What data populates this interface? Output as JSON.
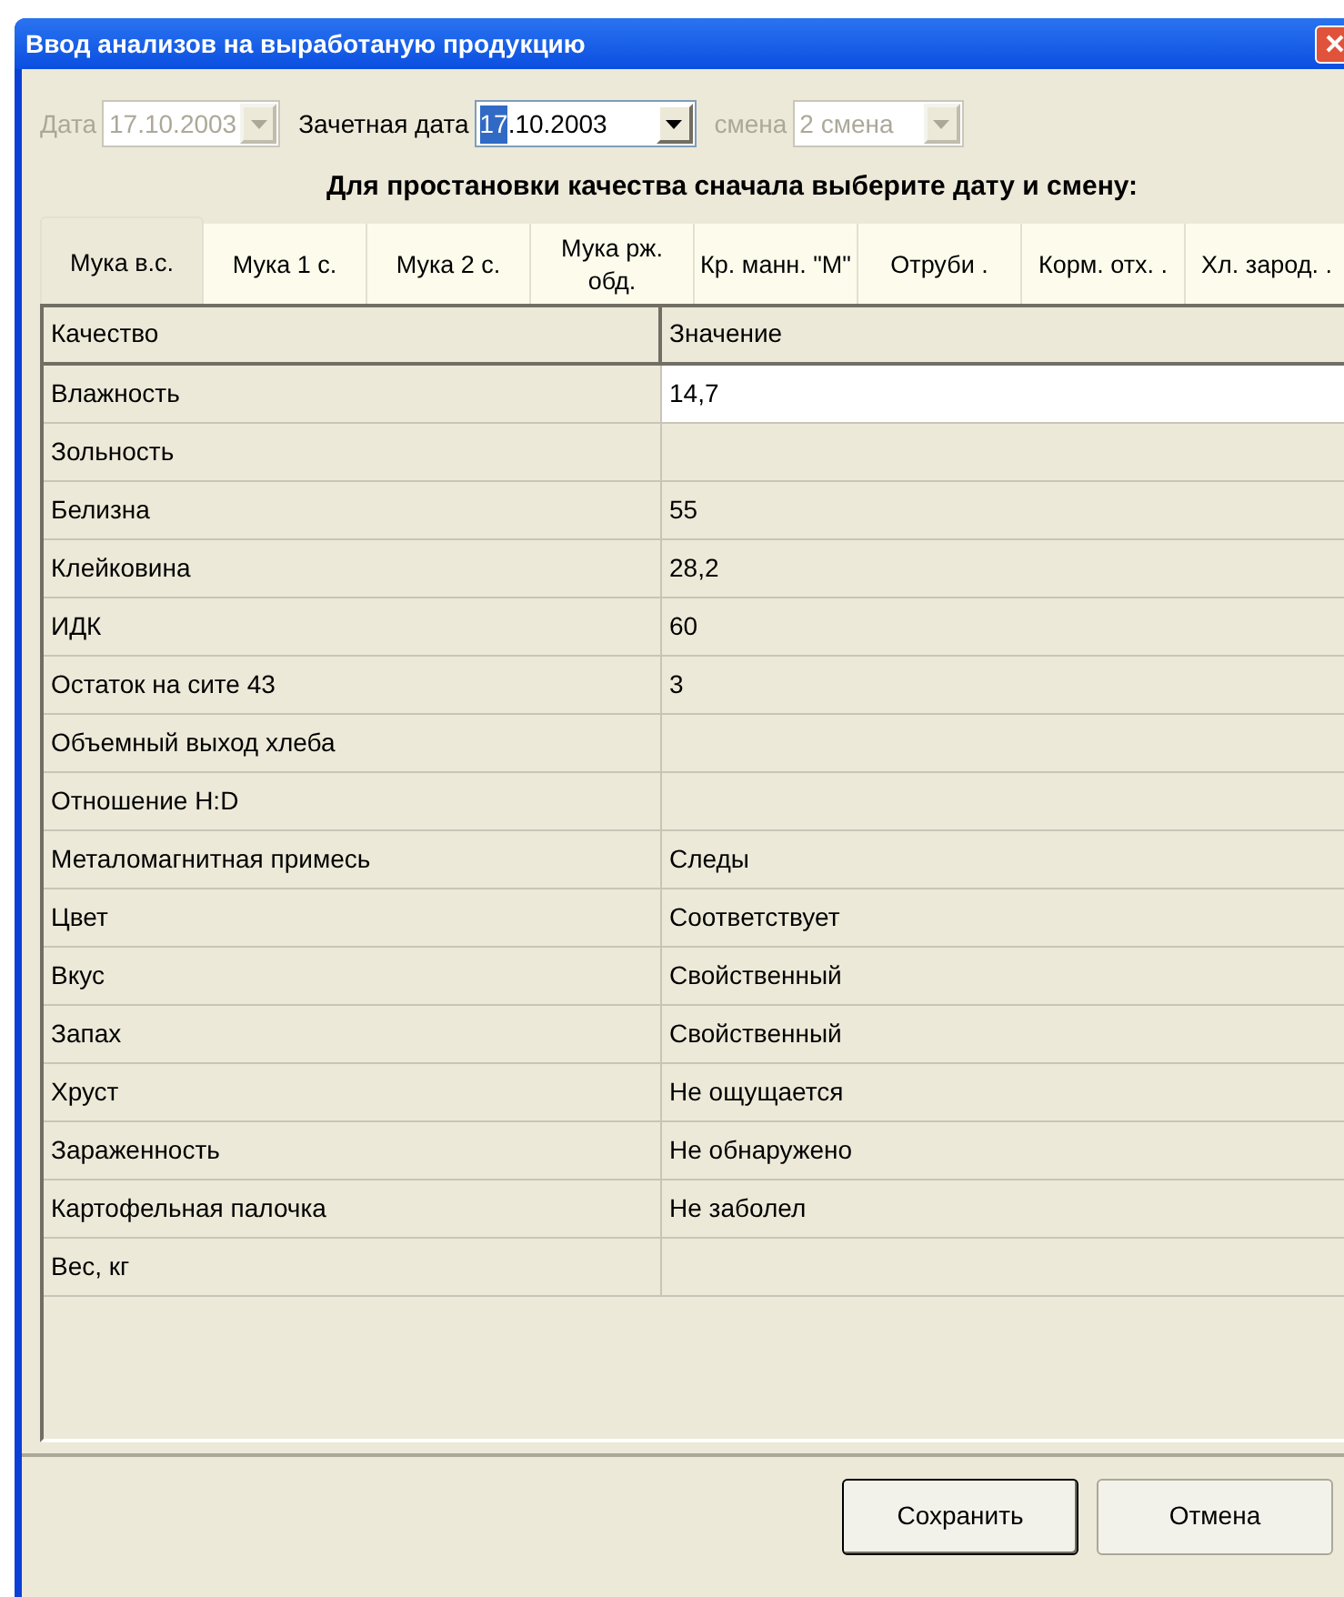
{
  "window": {
    "title": "Ввод анализов на выработаную продукцию"
  },
  "filters": [
    {
      "kind": "combo",
      "label": "Дата",
      "value": "17.10.2003",
      "disabled": true
    },
    {
      "kind": "date",
      "label": "Зачетная дата",
      "highlighted": "17",
      "rest": ".10.2003",
      "disabled": false
    },
    {
      "kind": "combo",
      "label": "смена",
      "value": "2 смена",
      "disabled": true
    }
  ],
  "instruction": "Для простановки качества сначала выберите дату и смену:",
  "tabs": [
    {
      "label": "Мука в.с.",
      "selected": true
    },
    {
      "label": "Мука 1 с.",
      "selected": false
    },
    {
      "label": "Мука 2 с.",
      "selected": false
    },
    {
      "label": "Мука рж. обд.",
      "selected": false
    },
    {
      "label": "Кр. манн. \"М\"",
      "selected": false
    },
    {
      "label": "Отруби .",
      "selected": false
    },
    {
      "label": "Корм. отх. .",
      "selected": false
    },
    {
      "label": "Хл. зарод. .",
      "selected": false
    }
  ],
  "table": {
    "columns": [
      "Качество",
      "Значение"
    ],
    "rows": [
      {
        "quality": "Влажность",
        "value": "14,7",
        "selected": true
      },
      {
        "quality": "Зольность",
        "value": "",
        "selected": false
      },
      {
        "quality": "Белизна",
        "value": "55",
        "selected": false
      },
      {
        "quality": "Клейковина",
        "value": "28,2",
        "selected": false
      },
      {
        "quality": "ИДК",
        "value": "60",
        "selected": false
      },
      {
        "quality": "Остаток на сите 43",
        "value": "3",
        "selected": false
      },
      {
        "quality": "Объемный выход хлеба",
        "value": "",
        "selected": false
      },
      {
        "quality": "Отношение H:D",
        "value": "",
        "selected": false
      },
      {
        "quality": "Металомагнитная примесь",
        "value": "Следы",
        "selected": false
      },
      {
        "quality": "Цвет",
        "value": "Соответствует",
        "selected": false
      },
      {
        "quality": "Вкус",
        "value": "Свойственный",
        "selected": false
      },
      {
        "quality": "Запах",
        "value": "Свойственный",
        "selected": false
      },
      {
        "quality": "Хруст",
        "value": "Не ощущается",
        "selected": false
      },
      {
        "quality": "Зараженность",
        "value": "Не обнаружено",
        "selected": false
      },
      {
        "quality": "Картофельная палочка",
        "value": "Не заболел",
        "selected": false
      },
      {
        "quality": "Вес, кг",
        "value": "",
        "selected": false
      }
    ]
  },
  "buttons": [
    {
      "label": "Сохранить",
      "default": true
    },
    {
      "label": "Отмена",
      "default": false
    }
  ]
}
